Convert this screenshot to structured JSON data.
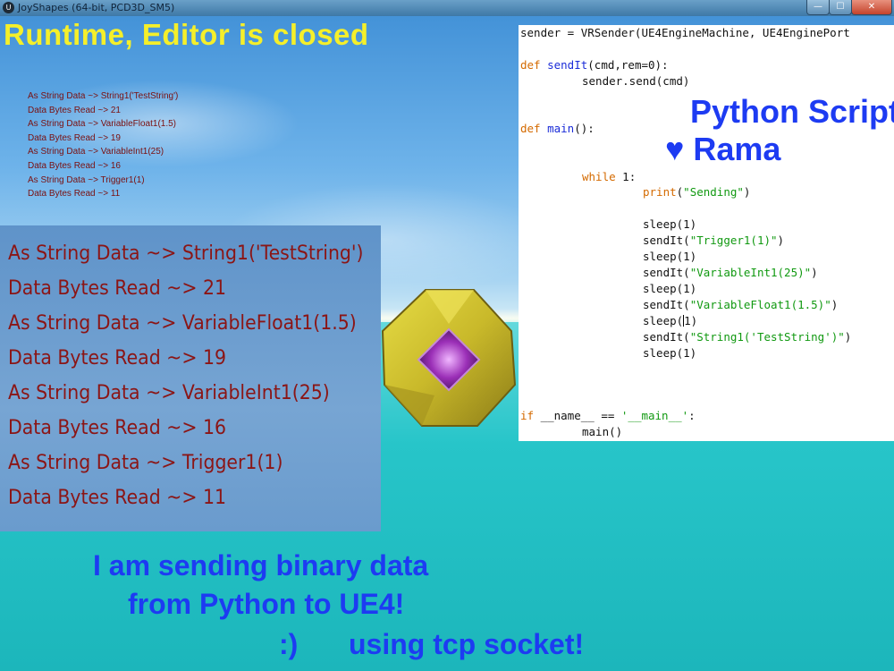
{
  "window": {
    "title": "JoyShapes (64-bit, PCD3D_SM5)",
    "app_icon": "unreal-engine-icon",
    "buttons": {
      "minimize_icon": "minimize-icon",
      "maximize_icon": "maximize-icon",
      "close_icon": "close-icon",
      "minimize": "—",
      "maximize": "☐",
      "close": "✕"
    }
  },
  "headline": "Runtime, Editor is closed",
  "small_log": [
    "As String Data ~> String1('TestString')",
    "Data Bytes Read ~> 21",
    "As String Data ~> VariableFloat1(1.5)",
    "Data Bytes Read ~> 19",
    "As String Data ~> VariableInt1(25)",
    "Data Bytes Read ~> 16",
    "As String Data ~> Trigger1(1)",
    "Data Bytes Read ~> 11"
  ],
  "big_log": [
    "As String Data ~> String1('TestString')",
    "Data Bytes Read ~> 21",
    "As String Data ~> VariableFloat1(1.5)",
    "Data Bytes Read ~> 19",
    "As String Data ~> VariableInt1(25)",
    "Data Bytes Read ~> 16",
    "As String Data ~> Trigger1(1)",
    "Data Bytes Read ~> 11"
  ],
  "code": {
    "l1": "sender = VRSender(UE4EngineMachine, UE4EnginePort",
    "l2_kw": "def",
    "l2_fn": "sendIt",
    "l2_rest": "(cmd,rem=0):",
    "l3": "sender.send(cmd)",
    "l4_kw": "def",
    "l4_fn": "main",
    "l4_rest": "():",
    "l5_kw": "while",
    "l5_rest": " 1:",
    "l6_fn": "print",
    "l6_str": "\"Sending\"",
    "sleep": "sleep(1)",
    "sendit": "sendIt",
    "s1": "\"Trigger1(1)\"",
    "s2": "\"VariableInt1(25)\"",
    "s3": "\"VariableFloat1(1.5)\"",
    "sleep_cursor_a": "sleep(",
    "sleep_cursor_b": "1)",
    "s4": "\"String1('TestString')\"",
    "l_if_kw": "if",
    "l_if_rest": " __name__ == ",
    "l_if_str": "'__main__'",
    "l_if_end": ":",
    "l_main": "main()"
  },
  "overlay": {
    "python": "Python Script!",
    "rama": "♥ Rama",
    "line1": "I am sending binary data",
    "line2": "from Python to UE4!",
    "smile": ":)",
    "tcp": "using tcp socket!"
  },
  "colors": {
    "headline": "#f5ef2a",
    "log_text": "#8b1515",
    "overlay_blue": "#1d3bf2",
    "code_keyword": "#d46a00",
    "code_function": "#1a2bd8",
    "code_string": "#119911"
  }
}
